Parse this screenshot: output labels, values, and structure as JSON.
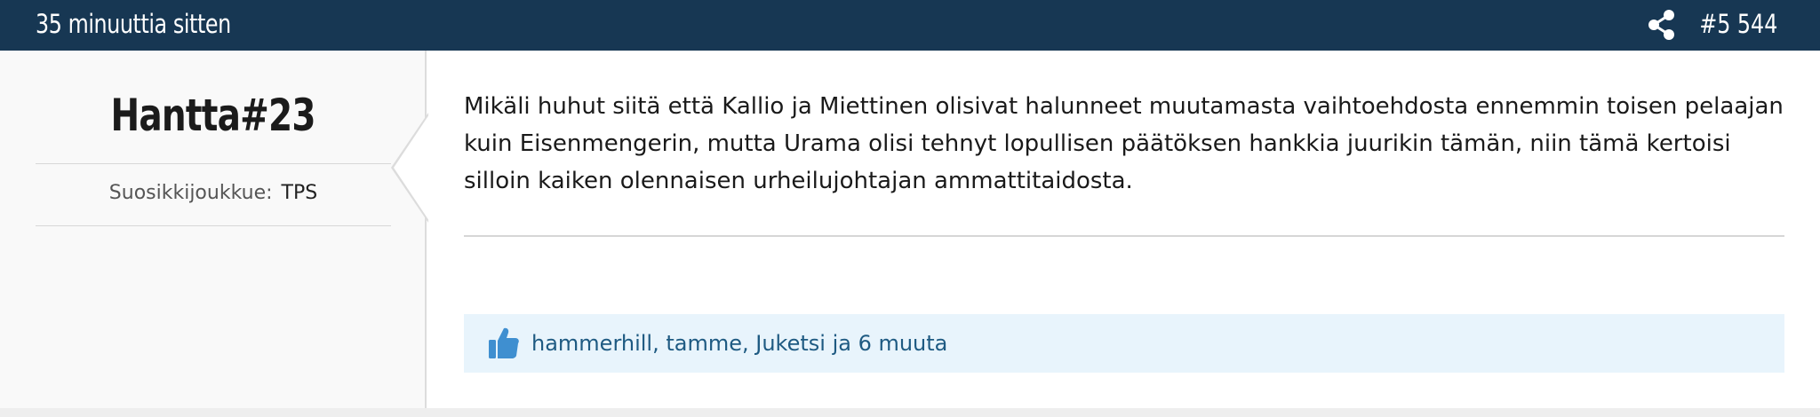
{
  "post": {
    "time_ago": "35 minuuttia sitten",
    "number": "#5 544",
    "share_icon": "share-icon"
  },
  "user": {
    "name": "Hantta#23",
    "favorite_team_label": "Suosikkijoukkue:",
    "favorite_team_value": "TPS"
  },
  "content": {
    "text": "Mikäli huhut siitä että Kallio ja Miettinen olisivat halunneet muutamasta vaihtoehdosta ennemmin toisen pelaajan kuin Eisenmengerin, mutta Urama olisi tehnyt lopullisen päätöksen hankkia juurikin tämän, niin tämä kertoisi silloin kaiken olennaisen urheilujohtajan ammattitaidosta."
  },
  "likes": {
    "icon": "thumbs-up-icon",
    "text": "hammerhill, tamme, Juketsi ja 6 muuta"
  },
  "colors": {
    "header_bg": "#173753",
    "likes_bg": "#e8f4fc",
    "likes_text": "#1e5a82",
    "like_icon": "#3f8fd0"
  }
}
